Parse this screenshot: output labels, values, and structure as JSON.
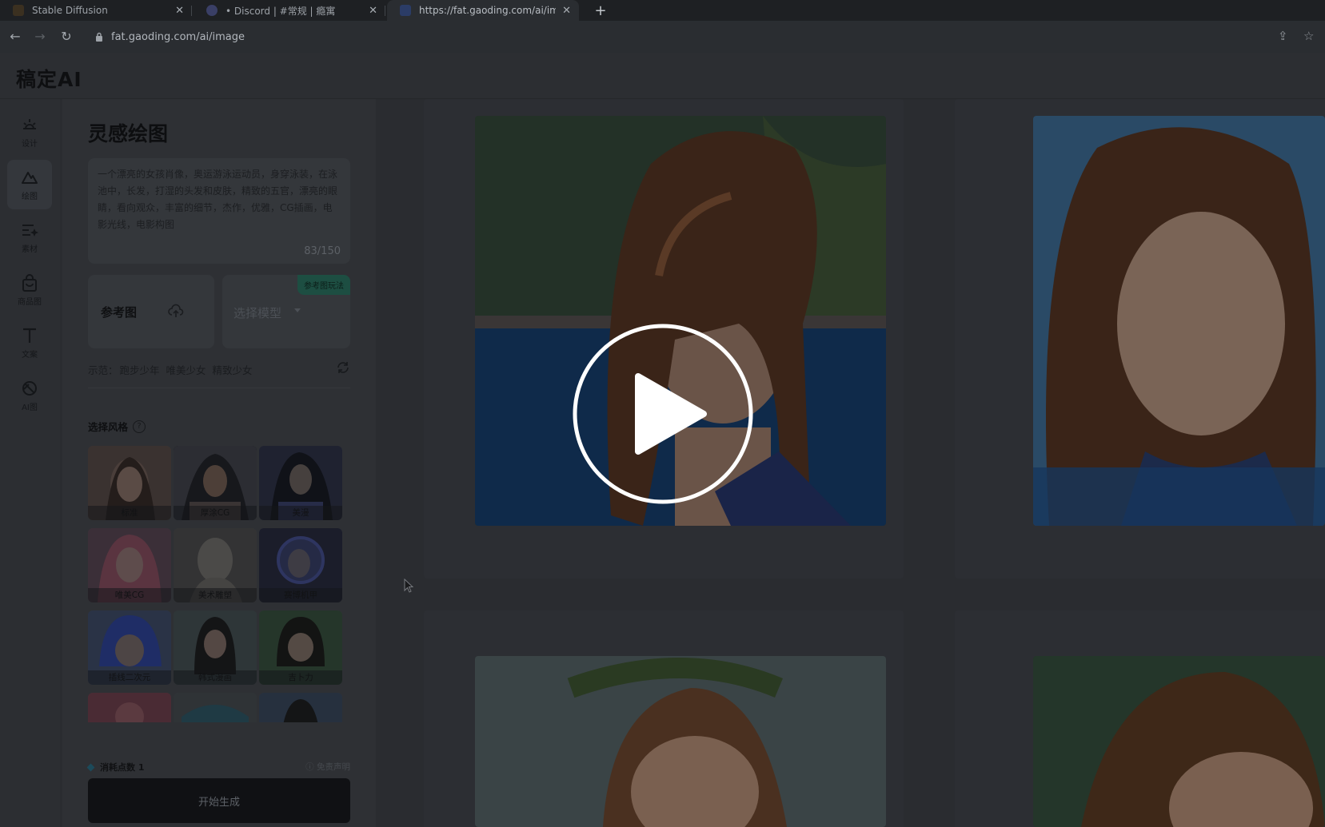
{
  "browser": {
    "tabs": [
      {
        "title": "Stable Diffusion",
        "active": false
      },
      {
        "title": "• Discord | #常规 | 瘾寓",
        "active": false
      },
      {
        "title": "https://fat.gaoding.com/ai/im",
        "active": true
      }
    ],
    "new_tab": "+",
    "url": "fat.gaoding.com/ai/image"
  },
  "app": {
    "logo": "稿定AI",
    "rail": [
      {
        "label": "设计",
        "icon": "sunrise-icon"
      },
      {
        "label": "绘图",
        "icon": "mountain-icon",
        "active": true
      },
      {
        "label": "素材",
        "icon": "list-sparkle-icon"
      },
      {
        "label": "商品图",
        "icon": "shopping-bag-icon"
      },
      {
        "label": "文案",
        "icon": "text-icon"
      },
      {
        "label": "AI图",
        "icon": "ai-image-icon"
      }
    ],
    "panel": {
      "title": "灵感绘图",
      "prompt": "一个漂亮的女孩肖像，奥运游泳运动员，身穿泳装，在泳池中，长发，打湿的头发和皮肤，精致的五官，漂亮的眼睛，看向观众，丰富的细节，杰作，优雅，CG插画，电影光线，电影构图",
      "char_count": "83/150",
      "reference_label": "参考图",
      "model_placeholder": "选择模型",
      "reference_badge": "参考图玩法",
      "examples_label": "示范：",
      "examples": [
        "跑步少年",
        "唯美少女",
        "精致少女"
      ],
      "style_heading": "选择风格",
      "styles": [
        {
          "label": "标准",
          "selected": false
        },
        {
          "label": "厚涂CG",
          "selected": true
        },
        {
          "label": "美漫",
          "selected": false
        },
        {
          "label": "唯美CG",
          "selected": false
        },
        {
          "label": "美术雕塑",
          "selected": false
        },
        {
          "label": "赛博机甲",
          "selected": false
        },
        {
          "label": "插线二次元",
          "selected": false
        },
        {
          "label": "韩式漫画",
          "selected": false
        },
        {
          "label": "吉卜力",
          "selected": false
        },
        {
          "label": "",
          "selected": false
        },
        {
          "label": "",
          "selected": false
        },
        {
          "label": "",
          "selected": false
        }
      ],
      "cost_label": "消耗点数 1",
      "disclaimer": "免责声明",
      "generate_label": "开始生成"
    }
  },
  "colors": {
    "overlay_bg": "#2a2c30",
    "button": "#101114",
    "badge": "#1d4e42"
  }
}
